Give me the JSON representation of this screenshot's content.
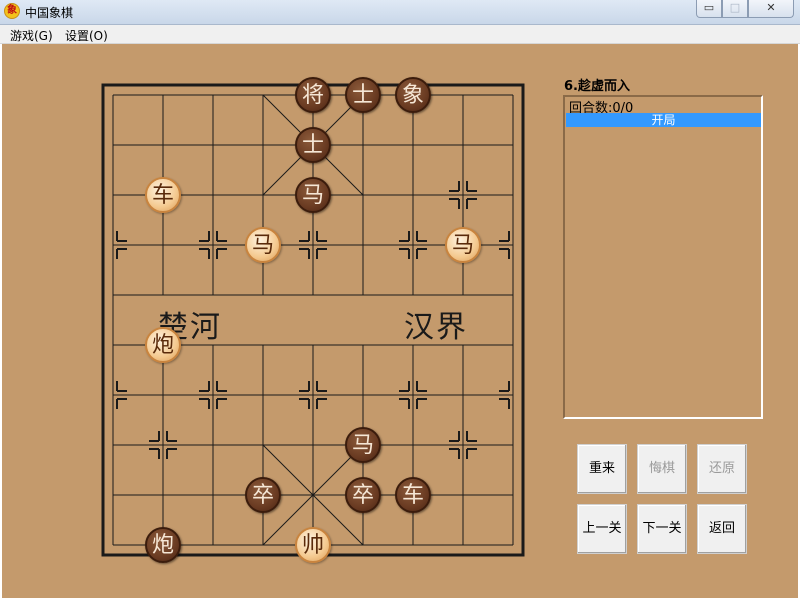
{
  "window": {
    "title": "中国象棋",
    "app_icon_glyph": "象",
    "minimize_glyph": "▭",
    "maximize_glyph": "□",
    "close_glyph": "✕"
  },
  "menu": {
    "game": "游戏(G)",
    "settings": "设置(O)"
  },
  "board": {
    "river_left": "楚河",
    "river_right": "汉界",
    "files": 9,
    "ranks": 10,
    "colors": {
      "background": "#c49a6c",
      "lines": "#1a1a1a"
    },
    "pieces": [
      {
        "side": "dark",
        "label": "将",
        "file": 4,
        "rank": 0
      },
      {
        "side": "dark",
        "label": "士",
        "file": 5,
        "rank": 0
      },
      {
        "side": "dark",
        "label": "象",
        "file": 6,
        "rank": 0
      },
      {
        "side": "dark",
        "label": "士",
        "file": 4,
        "rank": 1
      },
      {
        "side": "dark",
        "label": "马",
        "file": 4,
        "rank": 2
      },
      {
        "side": "light",
        "label": "车",
        "file": 1,
        "rank": 2
      },
      {
        "side": "light",
        "label": "马",
        "file": 3,
        "rank": 3
      },
      {
        "side": "light",
        "label": "马",
        "file": 7,
        "rank": 3
      },
      {
        "side": "light",
        "label": "炮",
        "file": 1,
        "rank": 5
      },
      {
        "side": "dark",
        "label": "马",
        "file": 5,
        "rank": 7
      },
      {
        "side": "dark",
        "label": "卒",
        "file": 3,
        "rank": 8
      },
      {
        "side": "dark",
        "label": "卒",
        "file": 5,
        "rank": 8
      },
      {
        "side": "dark",
        "label": "车",
        "file": 6,
        "rank": 8
      },
      {
        "side": "dark",
        "label": "炮",
        "file": 1,
        "rank": 9
      },
      {
        "side": "light",
        "label": "帅",
        "file": 4,
        "rank": 9
      }
    ]
  },
  "panel": {
    "level_title": "6.趁虚而入",
    "move_count": "回合数:0/0",
    "selected_move": "开局",
    "buttons": {
      "restart": "重来",
      "undo": "悔棋",
      "redo": "还原",
      "prev_level": "上一关",
      "next_level": "下一关",
      "back": "返回"
    }
  }
}
